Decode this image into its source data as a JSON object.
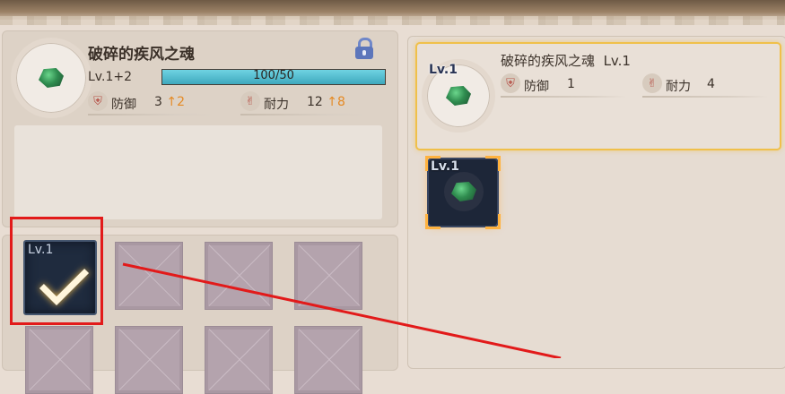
{
  "left_card": {
    "name": "破碎的疾风之魂",
    "level": "Lv.1+2",
    "exp": {
      "text": "100/50",
      "fill": 1.0
    },
    "stats": [
      {
        "icon": "shield-icon",
        "label": "防御",
        "value": "3",
        "up_arrow": "↑",
        "up": "2"
      },
      {
        "icon": "gauntlet-icon",
        "label": "耐力",
        "value": "12",
        "up_arrow": "↑",
        "up": "8"
      }
    ]
  },
  "inventory": {
    "selected_slot": {
      "level": "Lv.1"
    }
  },
  "compare_card": {
    "badge": "Lv.1",
    "name": "破碎的疾风之魂",
    "level": "Lv.1",
    "stats": [
      {
        "icon": "shield-icon",
        "label": "防御",
        "value": "1"
      },
      {
        "icon": "gauntlet-icon",
        "label": "耐力",
        "value": "4"
      }
    ]
  },
  "target_slot": {
    "level": "Lv.1"
  },
  "colors": {
    "highlight": "#f0c04a",
    "annotation": "#e21a1a",
    "exp_bar": "#3ea8bd",
    "upgrade": "#e58a24"
  }
}
